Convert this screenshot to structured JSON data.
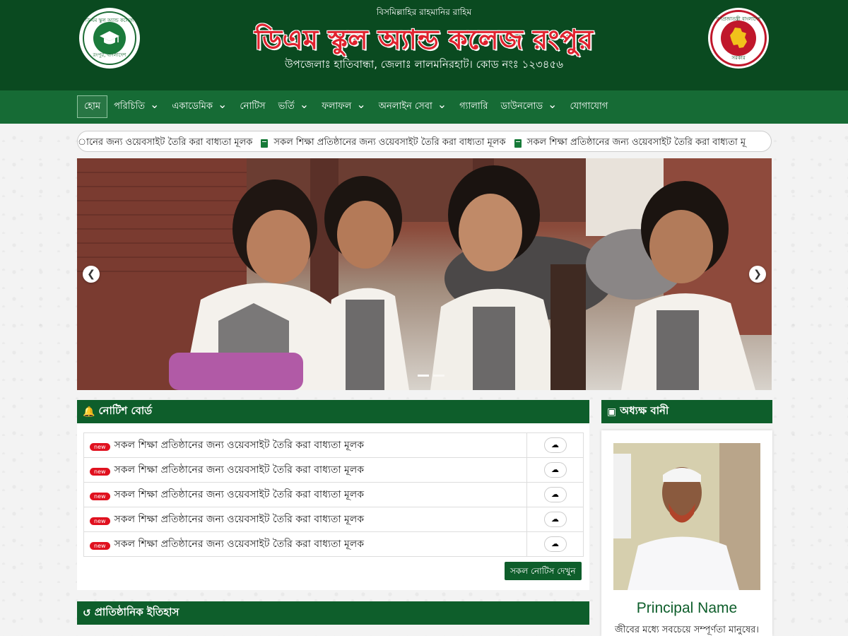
{
  "header": {
    "bismillah": "বিসমিল্লাহির রাহমানির রাহিম",
    "school_name": "ডিএম স্কুল অ্যান্ড কলেজ রংপুর",
    "address": "উপজেলাঃ হাতিবান্ধা, জেলাঃ লালমনিরহাট। কোড নংঃ ১২৩৪৫৬",
    "left_logo": {
      "top_text": "ডিএম স্কুল অ্যান্ড কলেজ",
      "bottom_text": "রংপুর, বাংলাদেশ"
    },
    "right_logo": {
      "top_text": "গণপ্রজাতন্ত্রী বাংলাদেশ",
      "bottom_text": "সরকার"
    }
  },
  "nav": {
    "items": [
      {
        "label": "হোম",
        "dropdown": false,
        "active": true
      },
      {
        "label": "পরিচিতি",
        "dropdown": true
      },
      {
        "label": "একাডেমিক",
        "dropdown": true
      },
      {
        "label": "নোটিস",
        "dropdown": false
      },
      {
        "label": "ভর্তি",
        "dropdown": true
      },
      {
        "label": "ফলাফল",
        "dropdown": true
      },
      {
        "label": "অনলাইন সেবা",
        "dropdown": true
      },
      {
        "label": "গ্যালারি",
        "dropdown": false
      },
      {
        "label": "ডাউনলোড",
        "dropdown": true
      },
      {
        "label": "যোগাযোগ",
        "dropdown": false
      }
    ]
  },
  "marquee": {
    "first_text": "ানের জন্য ওয়েবসাইট তৈরি করা বাধ্যতা মূলক",
    "text": "সকল শিক্ষা প্রতিষ্ঠানের জন্য ওয়েবসাইট তৈরি করা বাধ্যতা মূলক",
    "last_text": "সকল শিক্ষা প্রতিষ্ঠানের জন্য ওয়েবসাইট তৈরি করা বাধ্যতা মূ"
  },
  "notice_board": {
    "title": "নোটিশ বোর্ড",
    "badge": "new",
    "items": [
      "সকল শিক্ষা প্রতিষ্ঠানের জন্য ওয়েবসাইট তৈরি করা বাধ্যতা মূলক",
      "সকল শিক্ষা প্রতিষ্ঠানের জন্য ওয়েবসাইট তৈরি করা বাধ্যতা মূলক",
      "সকল শিক্ষা প্রতিষ্ঠানের জন্য ওয়েবসাইট তৈরি করা বাধ্যতা মূলক",
      "সকল শিক্ষা প্রতিষ্ঠানের জন্য ওয়েবসাইট তৈরি করা বাধ্যতা মূলক",
      "সকল শিক্ষা প্রতিষ্ঠানের জন্য ওয়েবসাইট তৈরি করা বাধ্যতা মূলক"
    ],
    "all_button": "সকল নোটিস দেখুন"
  },
  "history": {
    "title": "প্রাতিষ্ঠানিক ইতিহাস"
  },
  "principal": {
    "title": "অধ্যক্ষ বানী",
    "name": "Principal Name",
    "quote": "জীবের মধ্যে সবচেয়ে সম্পূর্ণতা মানুষের।"
  },
  "slider": {
    "prev_icon": "chevron-left-icon",
    "next_icon": "chevron-right-icon",
    "active_slide": 1,
    "slide_count": 2
  },
  "colors": {
    "header_bg": "#0a4a20",
    "nav_bg": "#166b35",
    "accent": "#0e5e2b",
    "title_red": "#e0222e",
    "badge_red": "#e0111f"
  }
}
